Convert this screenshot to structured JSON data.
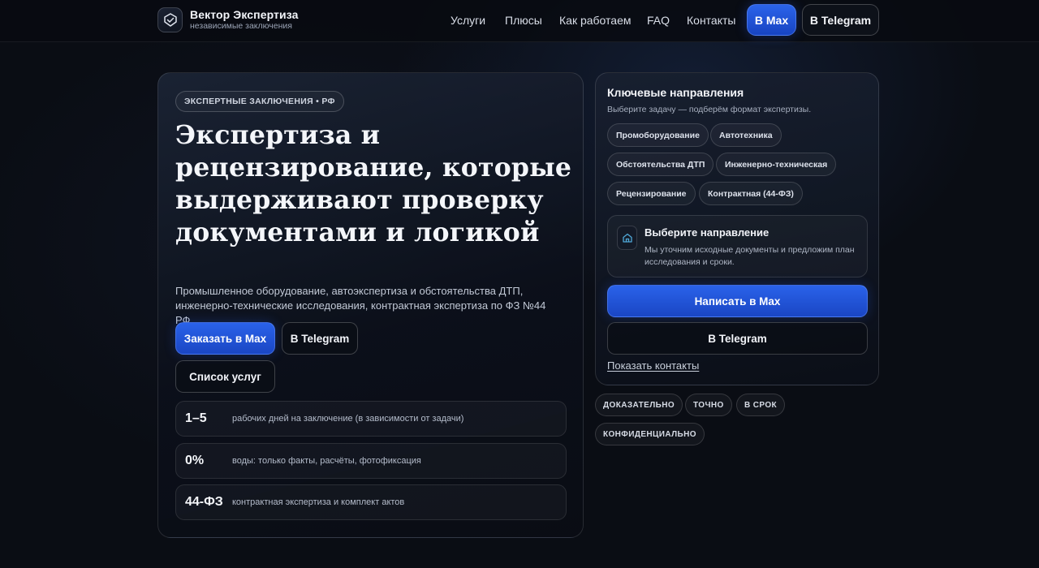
{
  "brand": {
    "name": "Вектор Экспертиза",
    "tagline": "независимые заключения",
    "logo_icon": "shield-check-icon"
  },
  "nav": {
    "links": [
      "Услуги",
      "Плюсы",
      "Как работаем",
      "FAQ",
      "Контакты"
    ],
    "max_button": "В Max",
    "telegram_button": "В Telegram"
  },
  "hero": {
    "eyebrow": "ЭКСПЕРТНЫЕ ЗАКЛЮЧЕНИЯ • РФ",
    "title": "Экспертиза и рецензирование, которые выдерживают проверку документами и логикой",
    "description": "Промышленное оборудование, автоэкспертиза и обстоятельства ДТП, инженерно-технические исследования, контрактная экспертиза по ФЗ №44 РФ.",
    "buttons": {
      "order": "Заказать в Max",
      "telegram": "В Telegram",
      "services": "Список услуг"
    },
    "stats": [
      {
        "value": "1–5",
        "text": "рабочих дней на заключение (в зависимости от задачи)"
      },
      {
        "value": "0%",
        "text": "воды: только факты, расчёты, фотофиксация"
      },
      {
        "value": "44-ФЗ",
        "text": "контрактная экспертиза и комплект актов"
      }
    ]
  },
  "side": {
    "title": "Ключевые направления",
    "subtitle": "Выберите задачу — подберём формат экспертизы.",
    "chips": [
      "Промоборудование",
      "Автотехника",
      "Обстоятельства ДТП",
      "Инженерно-техническая",
      "Рецензирование",
      "Контрактная (44-ФЗ)"
    ],
    "direction": {
      "icon": "home-icon",
      "title": "Выберите направление",
      "text": "Мы уточним исходные документы и предложим план исследования и сроки."
    },
    "write_button": "Написать в Max",
    "telegram_button": "В Telegram",
    "contacts_link": "Показать контакты"
  },
  "badges": [
    "ДОКАЗАТЕЛЬНО",
    "ТОЧНО",
    "В СРОК",
    "КОНФИДЕНЦИАЛЬНО"
  ],
  "colors": {
    "background": "#0a0d14",
    "accent": "#2a62ea",
    "text": "#e8ecf5"
  }
}
